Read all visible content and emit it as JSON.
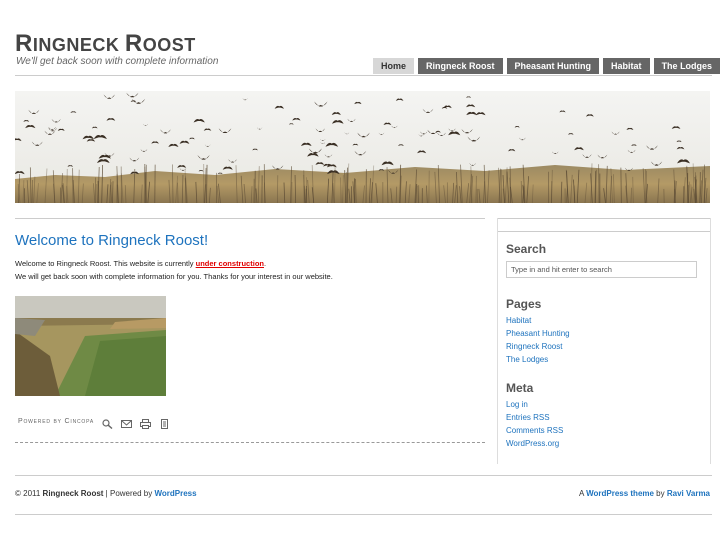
{
  "header": {
    "title_initial_1": "R",
    "title_rest_1": "ingneck ",
    "title_initial_2": "R",
    "title_rest_2": "oost",
    "tagline": "We'll get back soon with complete information"
  },
  "nav": {
    "items": [
      {
        "label": "Home",
        "active": true
      },
      {
        "label": "Ringneck Roost"
      },
      {
        "label": "Pheasant Hunting"
      },
      {
        "label": "Habitat"
      },
      {
        "label": "The Lodges"
      }
    ]
  },
  "post": {
    "title": "Welcome to Ringneck Roost!",
    "line1_a": "Welcome to Ringneck Roost. This website is currently ",
    "line1_link": "under construction",
    "line1_b": ".",
    "line2": "We will get back soon with complete information for you. Thanks for your interest in our website.",
    "powered_by": "Powered by Cincopa"
  },
  "sidebar": {
    "search_title": "Search",
    "search_placeholder": "Type in and hit enter to search",
    "pages_title": "Pages",
    "pages": [
      "Habitat",
      "Pheasant Hunting",
      "Ringneck Roost",
      "The Lodges"
    ],
    "meta_title": "Meta",
    "meta": [
      "Log in",
      "Entries RSS",
      "Comments RSS",
      "WordPress.org"
    ]
  },
  "footer": {
    "copyright": "© 2011 ",
    "site_name": "Ringneck Roost",
    "powered_text": " | Powered by ",
    "wordpress": "WordPress",
    "right_a": "A ",
    "theme_link": "WordPress theme",
    "right_by": " by ",
    "author_link": "Ravi Varma"
  },
  "colors": {
    "link": "#1e73be",
    "nav_bg": "#666666",
    "nav_active_bg": "#d7d7d7",
    "warning": "#e00000"
  }
}
